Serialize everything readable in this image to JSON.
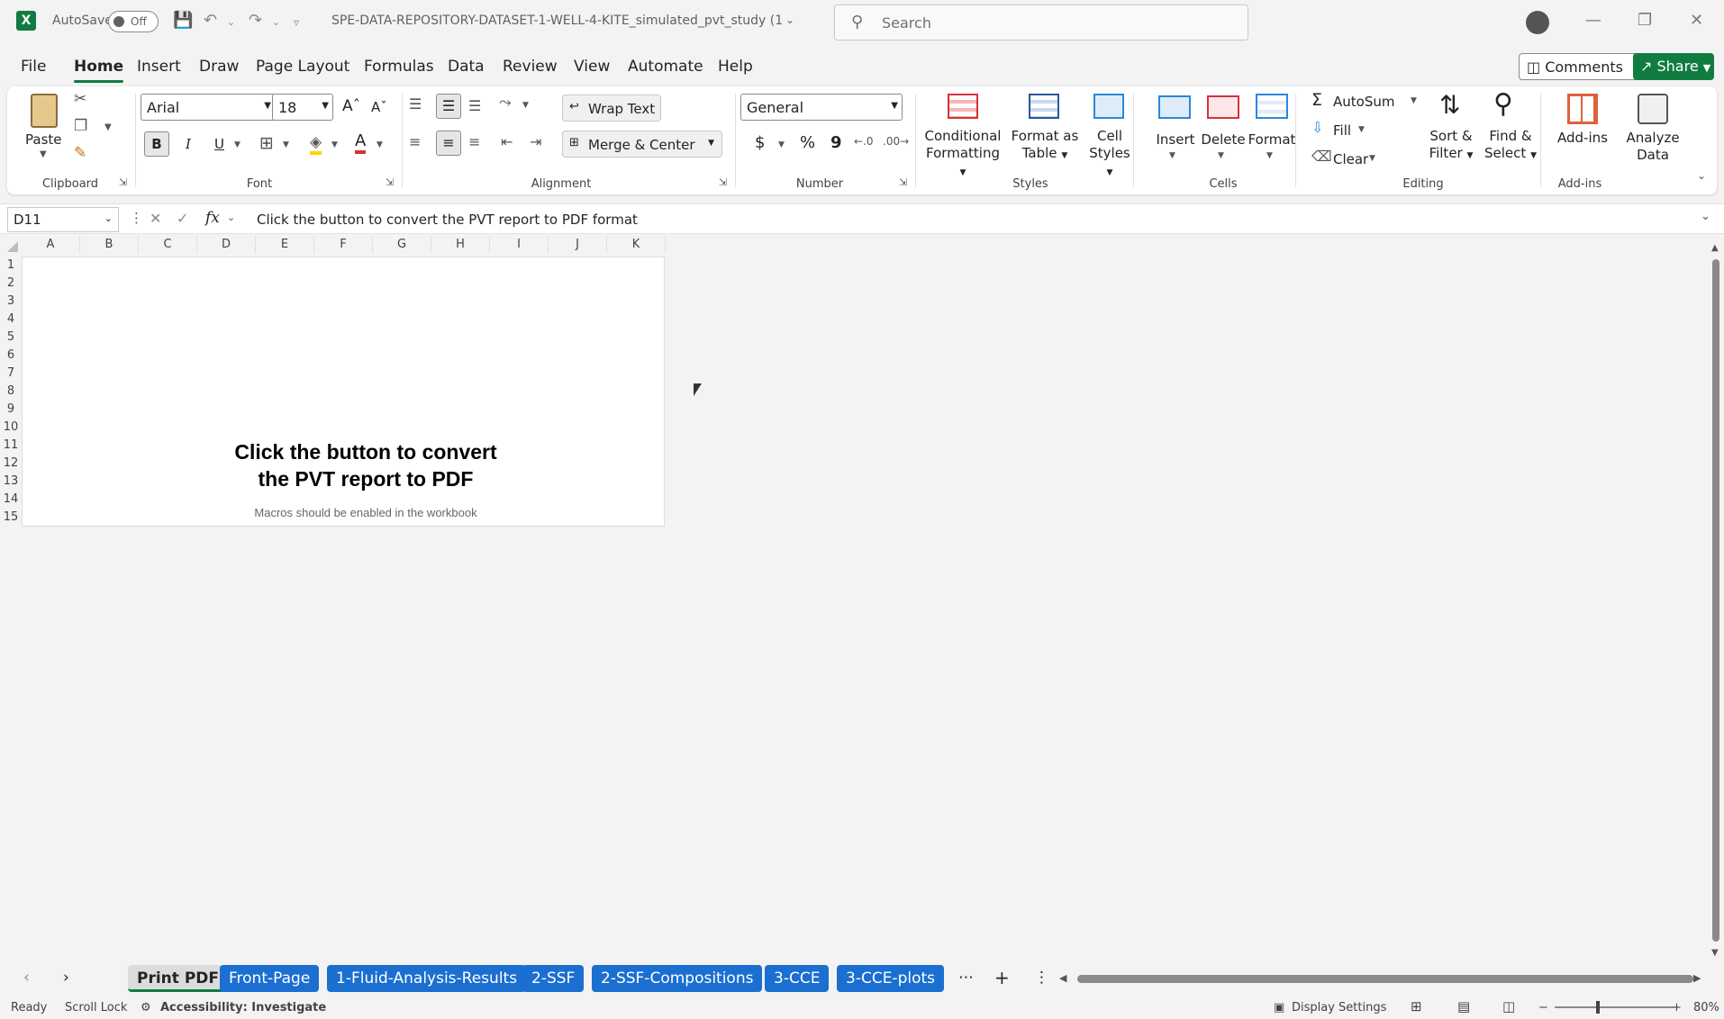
{
  "titlebar": {
    "autosave_label": "AutoSave",
    "autosave_state": "Off",
    "filename": "SPE-DATA-REPOSITORY-DATASET-1-WELL-4-KITE_simulated_pvt_study (1...",
    "search_placeholder": "Search"
  },
  "menu": {
    "items": [
      "File",
      "Home",
      "Insert",
      "Draw",
      "Page Layout",
      "Formulas",
      "Data",
      "Review",
      "View",
      "Automate",
      "Help"
    ],
    "comments_label": "Comments",
    "share_label": "Share"
  },
  "ribbon": {
    "clipboard": {
      "paste": "Paste",
      "group": "Clipboard"
    },
    "font": {
      "name": "Arial",
      "size": "18",
      "bold": "B",
      "italic": "I",
      "underline": "U",
      "group": "Font"
    },
    "alignment": {
      "wrap_text": "Wrap Text",
      "merge_center": "Merge & Center",
      "group": "Alignment"
    },
    "number": {
      "format": "General",
      "currency": "$",
      "percent": "%",
      "comma": "9",
      "group": "Number"
    },
    "styles": {
      "conditional": "Conditional",
      "conditional2": "Formatting",
      "format_table": "Format as",
      "format_table2": "Table",
      "cell_styles": "Cell",
      "cell_styles2": "Styles",
      "group": "Styles"
    },
    "cells": {
      "insert": "Insert",
      "delete": "Delete",
      "format": "Format",
      "group": "Cells"
    },
    "editing": {
      "autosum": "AutoSum",
      "fill": "Fill",
      "clear": "Clear",
      "sort": "Sort &",
      "sort2": "Filter",
      "find": "Find &",
      "find2": "Select",
      "group": "Editing"
    },
    "addins": {
      "addins": "Add-ins",
      "analyze": "Analyze",
      "analyze2": "Data",
      "group": "Add-ins"
    }
  },
  "formula_bar": {
    "cell_ref": "D11",
    "fx": "fx",
    "content": "Click the button to convert the PVT report to PDF format"
  },
  "grid": {
    "columns": [
      "A",
      "B",
      "C",
      "D",
      "E",
      "F",
      "G",
      "H",
      "I",
      "J",
      "K"
    ],
    "rows": [
      "1",
      "2",
      "3",
      "4",
      "5",
      "6",
      "7",
      "8",
      "9",
      "10",
      "11",
      "12",
      "13",
      "14",
      "15"
    ],
    "big_text_line1": "Click the button to convert",
    "big_text_line2": "the PVT report to PDF",
    "small_text": "Macros should be enabled in the workbook"
  },
  "sheets": {
    "tabs": [
      "Print PDF",
      "Front-Page",
      "1-Fluid-Analysis-Results",
      "2-SSF",
      "2-SSF-Compositions",
      "3-CCE",
      "3-CCE-plots"
    ],
    "active": "Print PDF"
  },
  "status": {
    "ready": "Ready",
    "scroll_lock": "Scroll Lock",
    "accessibility": "Accessibility: Investigate",
    "display_settings": "Display Settings",
    "zoom": "80%"
  }
}
